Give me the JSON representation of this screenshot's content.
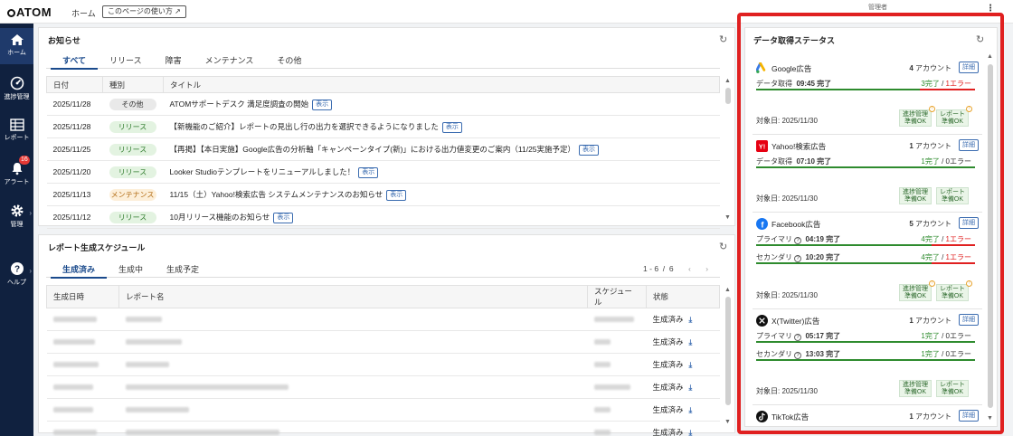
{
  "header": {
    "logo": "ATOM",
    "home_link": "ホーム",
    "howto_button": "このページの使い方",
    "user_name": "管理者"
  },
  "sidebar": {
    "items": [
      {
        "label": "ホーム",
        "icon": "home-icon"
      },
      {
        "label": "進捗管理",
        "icon": "gauge-icon"
      },
      {
        "label": "レポート",
        "icon": "grid-icon"
      },
      {
        "label": "アラート",
        "icon": "bell-icon",
        "badge": "16"
      },
      {
        "label": "管理",
        "icon": "gear-icon"
      },
      {
        "label": "ヘルプ",
        "icon": "help-icon"
      }
    ]
  },
  "news": {
    "title": "お知らせ",
    "tabs": [
      "すべて",
      "リリース",
      "障害",
      "メンテナンス",
      "その他"
    ],
    "columns": [
      "日付",
      "種別",
      "タイトル"
    ],
    "show_label": "表示",
    "rows": [
      {
        "date": "2025/11/28",
        "type": "その他",
        "title": "ATOMサポートデスク 満足度調査の開始"
      },
      {
        "date": "2025/11/28",
        "type": "リリース",
        "title": "【新機能のご紹介】レポートの見出し行の出力を選択できるようになりました"
      },
      {
        "date": "2025/11/25",
        "type": "リリース",
        "title": "【再掲】【本日実施】Google広告の分析軸「キャンペーンタイプ(新)」における出力値変更のご案内（11/25実施予定）"
      },
      {
        "date": "2025/11/20",
        "type": "リリース",
        "title": "Looker Studioテンプレートをリニューアルしました！"
      },
      {
        "date": "2025/11/13",
        "type": "メンテナンス",
        "title": "11/15（土）Yahoo!検索広告 システムメンテナンスのお知らせ"
      },
      {
        "date": "2025/11/12",
        "type": "リリース",
        "title": "10月リリース機能のお知らせ"
      }
    ]
  },
  "schedule": {
    "title": "レポート生成スケジュール",
    "tabs": [
      "生成済み",
      "生成中",
      "生成予定"
    ],
    "pager": {
      "start": "1",
      "sep": "-",
      "end": "6",
      "slash": "/",
      "total": "6"
    },
    "columns": [
      "生成日時",
      "レポート名",
      "スケジュール",
      "状態"
    ],
    "status_label": "生成済み",
    "row_count": 6
  },
  "status": {
    "title": "データ取得ステータス",
    "detail_label": "詳細",
    "cards": [
      {
        "name": "Google広告",
        "accounts": "4",
        "unit": "アカウント",
        "rows": [
          {
            "label": "データ取得",
            "time": "09:45 完了",
            "done": "3",
            "err": "1",
            "err_ratio": 0.25
          }
        ],
        "target": "対象日: 2025/11/30",
        "tags": [
          "進捗管理\n準備OK",
          "レポート\n準備OK"
        ],
        "warn": true
      },
      {
        "name": "Yahoo!検索広告",
        "accounts": "1",
        "unit": "アカウント",
        "rows": [
          {
            "label": "データ取得",
            "time": "07:10 完了",
            "done": "1",
            "err": "0",
            "err_ratio": 0
          }
        ],
        "target": "対象日: 2025/11/30",
        "tags": [
          "進捗管理\n準備OK",
          "レポート\n準備OK"
        ],
        "warn": false
      },
      {
        "name": "Facebook広告",
        "accounts": "5",
        "unit": "アカウント",
        "rows": [
          {
            "label": "プライマリ",
            "time": "04:19 完了",
            "done": "4",
            "err": "1",
            "err_ratio": 0.2
          },
          {
            "label": "セカンダリ",
            "time": "10:20 完了",
            "done": "4",
            "err": "1",
            "err_ratio": 0.2
          }
        ],
        "target": "対象日: 2025/11/30",
        "tags": [
          "進捗管理\n準備OK",
          "レポート\n準備OK"
        ],
        "warn": true
      },
      {
        "name": "X(Twitter)広告",
        "accounts": "1",
        "unit": "アカウント",
        "rows": [
          {
            "label": "プライマリ",
            "time": "05:17 完了",
            "done": "1",
            "err": "0",
            "err_ratio": 0
          },
          {
            "label": "セカンダリ",
            "time": "13:03 完了",
            "done": "1",
            "err": "0",
            "err_ratio": 0
          }
        ],
        "target": "対象日: 2025/11/30",
        "tags": [
          "進捗管理\n準備OK",
          "レポート\n準備OK"
        ],
        "warn": false
      },
      {
        "name": "TikTok広告",
        "accounts": "1",
        "unit": "アカウント",
        "rows": [],
        "target": "",
        "tags": [],
        "warn": false
      }
    ],
    "done_suffix": "完了",
    "err_suffix": "エラー"
  },
  "colors": {
    "sidebar": "#10213f",
    "accent": "#1a4a8c",
    "ok": "#2e8b2e",
    "error": "#e02020"
  }
}
